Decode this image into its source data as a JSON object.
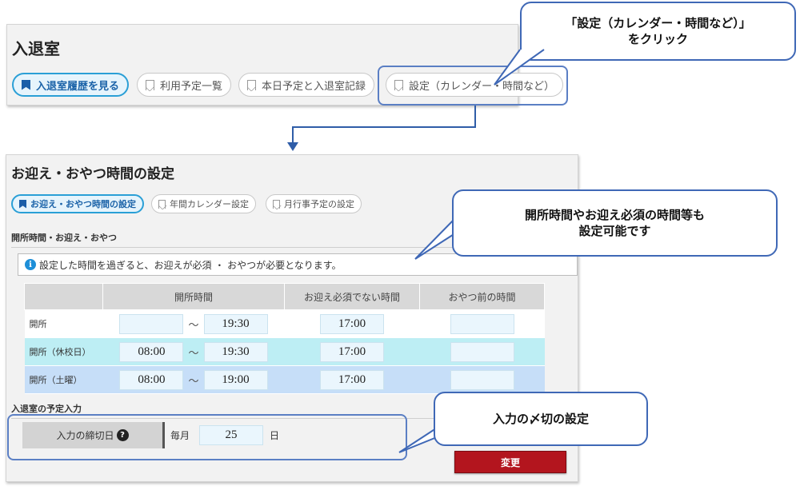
{
  "top": {
    "title": "入退室",
    "tabs": [
      {
        "label": "入退室履歴を見る",
        "active": true
      },
      {
        "label": "利用予定一覧",
        "active": false
      },
      {
        "label": "本日予定と入退室記録",
        "active": false
      },
      {
        "label": "設定（カレンダー・時間など）",
        "active": false
      }
    ]
  },
  "callouts": {
    "settings_click": {
      "line1": "「設定（カレンダー・時間など）」",
      "line2": "をクリック"
    },
    "hours_configurable": {
      "line1": "開所時間やお迎え必須の時間等も",
      "line2": "設定可能です"
    },
    "deadline": {
      "line1": "入力の〆切の設定"
    }
  },
  "main": {
    "title": "お迎え・おやつ時間の設定",
    "subtabs": [
      {
        "label": "お迎え・おやつ時間の設定",
        "active": true
      },
      {
        "label": "年間カレンダー設定",
        "active": false
      },
      {
        "label": "月行事予定の設定",
        "active": false
      }
    ],
    "section1_heading": "開所時間・お迎え・おやつ",
    "info_icon": "i",
    "info_text": "設定した時間を過ぎると、お迎えが必須 ・ おやつが必要となります。",
    "table": {
      "headers": [
        "",
        "開所時間",
        "お迎え必須でない時間",
        "おやつ前の時間"
      ],
      "separator": "～",
      "rows": [
        {
          "label": "開所",
          "open_from": "",
          "open_to": "19:30",
          "pickup_free_until": "17:00",
          "snack_before": ""
        },
        {
          "label": "開所（休校日）",
          "open_from": "08:00",
          "open_to": "19:30",
          "pickup_free_until": "17:00",
          "snack_before": ""
        },
        {
          "label": "開所（土曜）",
          "open_from": "08:00",
          "open_to": "19:00",
          "pickup_free_until": "17:00",
          "snack_before": ""
        }
      ]
    },
    "section2_heading": "入退室の予定入力",
    "deadline": {
      "label": "入力の締切日",
      "help_icon": "?",
      "prefix": "毎月",
      "value": "25",
      "suffix": "日"
    },
    "submit_label": "変更"
  },
  "colors": {
    "accent_blue": "#2a9fd6",
    "callout_border": "#3f68b6",
    "row_holiday": "#bdeef4",
    "row_saturday": "#c6def8",
    "submit_red": "#b3151e"
  }
}
